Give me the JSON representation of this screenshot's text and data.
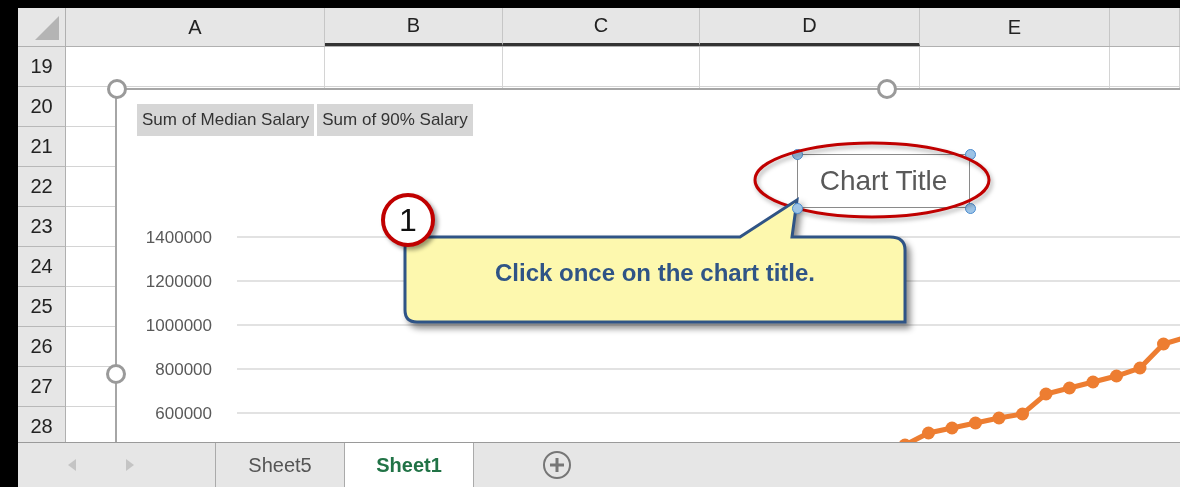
{
  "sheet": {
    "columns": [
      {
        "label": "A",
        "selected": false
      },
      {
        "label": "B",
        "selected": true
      },
      {
        "label": "C",
        "selected": true
      },
      {
        "label": "D",
        "selected": true
      },
      {
        "label": "E",
        "selected": false
      }
    ],
    "rows": [
      "19",
      "20",
      "21",
      "22",
      "23",
      "24",
      "25",
      "26",
      "27",
      "28"
    ]
  },
  "chart": {
    "field_buttons": [
      "Sum of Median Salary",
      "Sum of 90% Salary"
    ],
    "title": "Chart Title",
    "y_axis_labels": [
      "1400000",
      "1200000",
      "1000000",
      "800000",
      "600000"
    ]
  },
  "callout": {
    "step": "1",
    "text": "Click once on the chart title."
  },
  "sheet_tabs": [
    {
      "label": "Sheet5",
      "selected": false
    },
    {
      "label": "Sheet1",
      "selected": true
    }
  ]
}
